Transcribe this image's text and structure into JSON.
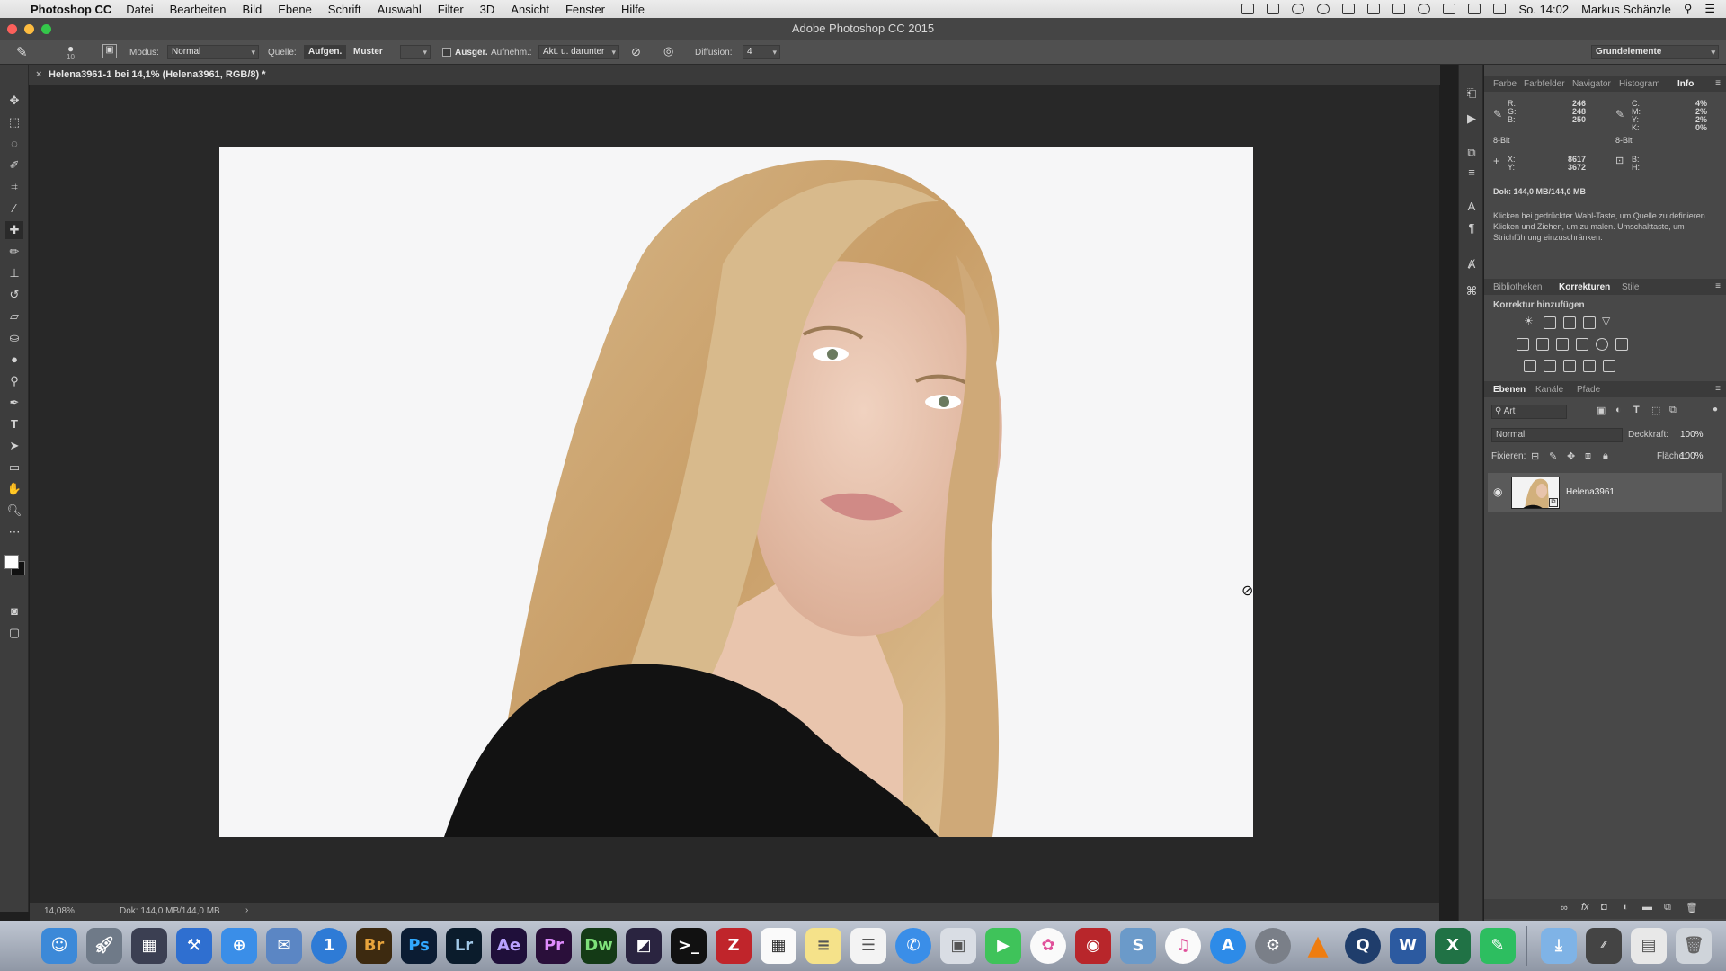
{
  "menubar": {
    "app": "Photoshop CC",
    "items": [
      "Datei",
      "Bearbeiten",
      "Bild",
      "Ebene",
      "Schrift",
      "Auswahl",
      "Filter",
      "3D",
      "Ansicht",
      "Fenster",
      "Hilfe"
    ],
    "clock": "So. 14:02",
    "user": "Markus Schänzle"
  },
  "window": {
    "title": "Adobe Photoshop CC 2015"
  },
  "options": {
    "brush_size": "10",
    "mode_label": "Modus:",
    "mode_value": "Normal",
    "source_label": "Quelle:",
    "source_sampled": "Aufgen.",
    "source_pattern": "Muster",
    "aligned_label": "Ausger.",
    "sample_label": "Aufnehm.:",
    "sample_value": "Akt. u. darunter",
    "diffusion_label": "Diffusion:",
    "diffusion_value": "4",
    "workspace": "Grundelemente"
  },
  "document": {
    "tab_title": "Helena3961-1 bei 14,1% (Helena3961, RGB/8) *",
    "zoom": "14,08%",
    "doc_size": "Dok: 144,0 MB/144,0 MB"
  },
  "info_panel": {
    "tabs": [
      "Farbe",
      "Farbfelder",
      "Navigator",
      "Histogram",
      "Info"
    ],
    "active_tab": "Info",
    "rgb_labels": [
      "R:",
      "G:",
      "B:"
    ],
    "rgb_values": [
      "246",
      "248",
      "250"
    ],
    "cmyk_labels": [
      "C:",
      "M:",
      "Y:",
      "K:"
    ],
    "cmyk_values": [
      "4%",
      "2%",
      "2%",
      "0%"
    ],
    "bit_left": "8-Bit",
    "bit_right": "8-Bit",
    "xy_labels": [
      "X:",
      "Y:"
    ],
    "xy_values": [
      "8617",
      "3672"
    ],
    "wh_labels": [
      "B:",
      "H:"
    ],
    "doc_info": "Dok: 144,0 MB/144,0 MB",
    "hint": "Klicken bei gedrückter Wahl-Taste, um Quelle zu definieren. Klicken und Ziehen, um zu malen. Umschalttaste, um Strichführung einzuschränken."
  },
  "adjust_panel": {
    "tabs": [
      "Bibliotheken",
      "Korrekturen",
      "Stile"
    ],
    "active_tab": "Korrekturen",
    "heading": "Korrektur hinzufügen"
  },
  "layers_panel": {
    "tabs": [
      "Ebenen",
      "Kanäle",
      "Pfade"
    ],
    "active_tab": "Ebenen",
    "filter": "Art",
    "blend_mode": "Normal",
    "opacity_label": "Deckkraft:",
    "opacity_value": "100%",
    "lock_label": "Fixieren:",
    "fill_label": "Fläche:",
    "fill_value": "100%",
    "layers": [
      {
        "name": "Helena3961",
        "visible": true
      }
    ]
  },
  "dock": {
    "apps": [
      "Finder",
      "Launchpad",
      "Mission Control",
      "Xcode",
      "Safari",
      "Mail",
      "1Password",
      "Br",
      "Ps",
      "Lr",
      "Ae",
      "Pr",
      "Dw",
      "Motion",
      "Terminal",
      "FileZilla",
      "Kalender",
      "Notizen",
      "Erinnerungen",
      "Nachrichten",
      "Vorschau",
      "FaceTime",
      "Fotos",
      "Photo Booth",
      "Skype",
      "iTunes",
      "App Store",
      "Systemeinstellungen",
      "VLC",
      "QuickTime",
      "Word",
      "Excel",
      "Evernote",
      "Downloads",
      "Brushes",
      "Dokumente",
      "Papierkorb"
    ]
  }
}
